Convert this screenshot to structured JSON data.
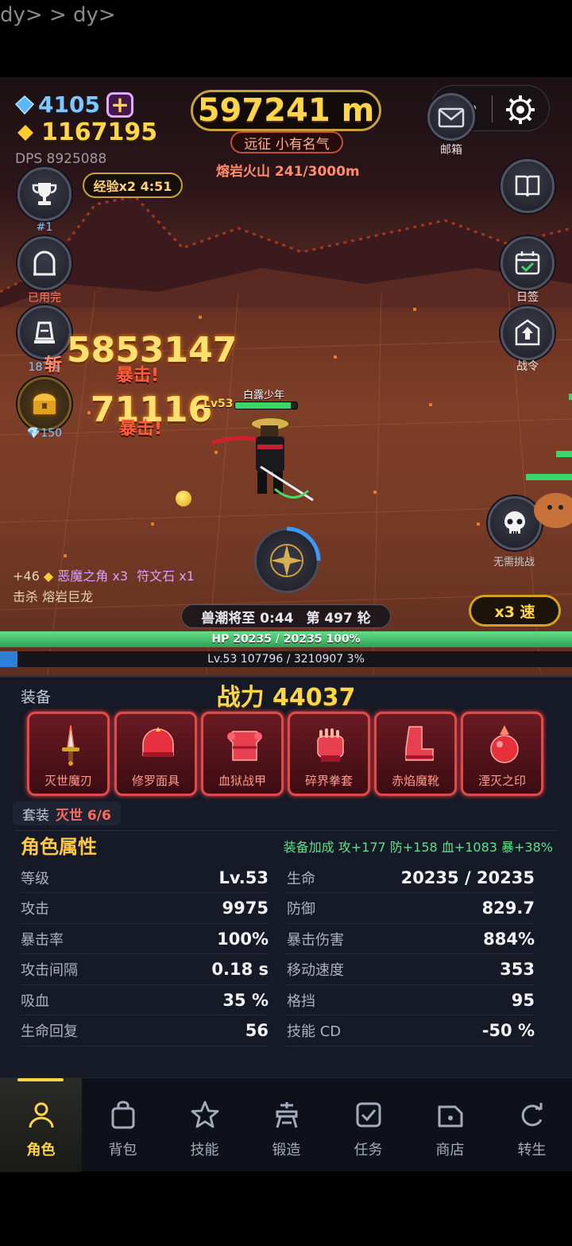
{
  "stray_text": "dy> > dy>",
  "hud": {
    "gems": "4105",
    "gems_plus": "+",
    "gold": "1167195",
    "dps": "DPS 8925088",
    "distance": "597241 m",
    "title": "远征 小有名气",
    "zone": "熔岩火山  241/3000m",
    "exp_boost": "经验x2 4:51",
    "mail_label": "邮箱"
  },
  "left_buttons": [
    {
      "label": "#1",
      "icon": "trophy-icon"
    },
    {
      "label": "已用完",
      "icon": "arch-icon"
    },
    {
      "label": "187层",
      "icon": "tower-icon"
    },
    {
      "label": "150",
      "icon": "treasure-chest-icon"
    }
  ],
  "right_buttons": [
    {
      "label": "",
      "icon": "book-icon"
    },
    {
      "label": "日签",
      "icon": "calendar-check-icon"
    },
    {
      "label": "战令",
      "icon": "battle-pass-icon"
    },
    {
      "label": "无需挑战",
      "icon": "skull-icon"
    }
  ],
  "combat": {
    "damage_1": "5853147",
    "crit_1": "暴击!",
    "slash": "斩",
    "damage_2": "71116",
    "crit_2": "暴击!",
    "player_name": "白露少年",
    "player_level": "Lv53",
    "player_hp_fraction": 0.9
  },
  "loot": {
    "gold_gain": "+46",
    "item_1": "恶魔之角 x3",
    "item_2": "符文石 x1",
    "kill": "击杀 熔岩巨龙"
  },
  "wave": {
    "timer": "兽潮将至 0:44",
    "round": "第 497 轮"
  },
  "speed_label": "x3 速",
  "hp_bar": {
    "text": "HP  20235 / 20235  100%",
    "fraction": 1.0
  },
  "xp_bar": {
    "text": "Lv.53   107796 / 3210907   3%",
    "fraction": 0.03
  },
  "equipment": {
    "section_label": "装备",
    "power": "战力 44037",
    "slots": [
      "灭世魔刃",
      "修罗面具",
      "血狱战甲",
      "碎界拳套",
      "赤焰魔靴",
      "湮灭之印"
    ],
    "set_label": "套装",
    "set_value": "灭世 6/6"
  },
  "attributes": {
    "title": "角色属性",
    "bonus": "装备加成 攻+177 防+158 血+1083 暴+38%",
    "rows": [
      {
        "k": "等级",
        "v": "Lv.53"
      },
      {
        "k": "生命",
        "v": "20235 / 20235"
      },
      {
        "k": "攻击",
        "v": "9975"
      },
      {
        "k": "防御",
        "v": "829.7"
      },
      {
        "k": "暴击率",
        "v": "100%"
      },
      {
        "k": "暴击伤害",
        "v": "884%"
      },
      {
        "k": "攻击间隔",
        "v": "0.18 s"
      },
      {
        "k": "移动速度",
        "v": "353"
      },
      {
        "k": "吸血",
        "v": "35 %"
      },
      {
        "k": "格挡",
        "v": "95"
      },
      {
        "k": "生命回复",
        "v": "56"
      },
      {
        "k": "技能 CD",
        "v": "-50 %"
      }
    ]
  },
  "nav": {
    "tabs": [
      "角色",
      "背包",
      "技能",
      "锻造",
      "任务",
      "商店",
      "转生"
    ],
    "active": "角色"
  },
  "colors": {
    "accent": "#ffd54a",
    "legendary": "#e04a4a",
    "hp": "#3ad66a",
    "xp": "#2f7fd6"
  }
}
